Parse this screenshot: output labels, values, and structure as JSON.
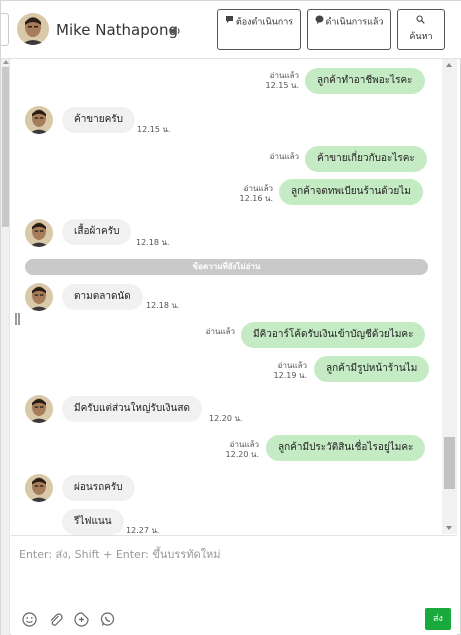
{
  "header": {
    "contact_name": "Mike Nathapong",
    "buttons": {
      "todo": "ต้องดำเนินการ",
      "done": "ดำเนินการแล้ว",
      "search": "ค้นหา"
    }
  },
  "messages": [
    {
      "dir": "out",
      "text": "ลูกค้าทำอาชีพอะไรคะ",
      "status": "อ่านแล้ว",
      "time": "12.15 น."
    },
    {
      "dir": "in",
      "text": "ค้าขายครับ",
      "time": "12.15 น."
    },
    {
      "dir": "out",
      "text": "ค้าขายเกี่ยวกับอะไรคะ",
      "status": "อ่านแล้ว",
      "time": ""
    },
    {
      "dir": "out",
      "text": "ลูกค้าจดทพเบียนร้านด้วยไม",
      "status": "อ่านแล้ว",
      "time": "12.16 น."
    },
    {
      "dir": "in",
      "text": "เสื้อผ้าครับ",
      "time": "12.18 น."
    },
    {
      "dir": "in",
      "text": "ตามตลาดนัด",
      "time": "12.18 น."
    },
    {
      "dir": "out",
      "text": "มีคิวอาร์โค้ดรับเงินเข้าบัญชีด้วยไมคะ",
      "status": "อ่านแล้ว",
      "time": ""
    },
    {
      "dir": "out",
      "text": "ลูกค้ามีรูปหน้าร้านไม",
      "status": "อ่านแล้ว",
      "time": "12.19 น."
    },
    {
      "dir": "in",
      "text": "มีครับแต่ส่วนใหญ่รับเงินสด",
      "time": "12.20 น."
    },
    {
      "dir": "out",
      "text": "ลูกค้ามีประวัติสินเชื่อไรอยู่ไมคะ",
      "status": "อ่านแล้ว",
      "time": "12.20 น."
    },
    {
      "dir": "in",
      "text": "ผ่อนรถครับ",
      "time": ""
    },
    {
      "dir": "in",
      "text": "รีไฟแนน",
      "time": "12.27 น."
    }
  ],
  "unread_separator": "ข้อความที่ยังไม่อ่าน",
  "composer": {
    "placeholder": "Enter: ส่ง, Shift + Enter: ขึ้นบรรทัดใหม่",
    "send_label": "ส่ง"
  },
  "icons": {
    "speaker": "speaker-icon",
    "comment": "comment-icon",
    "messenger": "messenger-icon",
    "search": "search-icon",
    "emoji": "emoji-icon",
    "attach": "paperclip-icon",
    "sticker": "sticker-icon",
    "whatsapp": "whatsapp-icon"
  },
  "colors": {
    "outgoing_bubble": "#c5ebc5",
    "incoming_bubble": "#f1f1f1",
    "send_button": "#19a93c",
    "separator": "#c9c9c9"
  }
}
